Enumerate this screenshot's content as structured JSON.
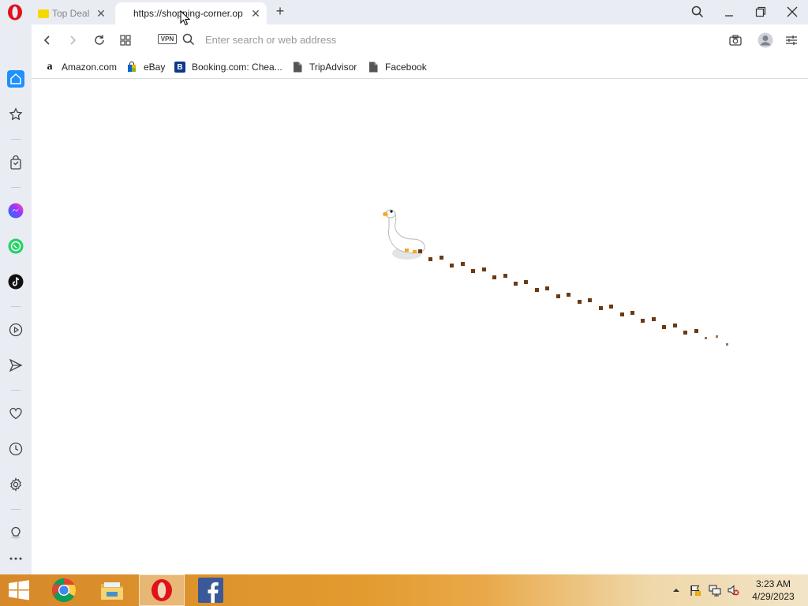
{
  "tabs": [
    {
      "title": "Top Deal",
      "active": false
    },
    {
      "title": "https://shopping-corner.op",
      "active": true
    }
  ],
  "address_bar": {
    "placeholder": "Enter search or web address",
    "value": "",
    "vpn_label": "VPN"
  },
  "bookmarks": [
    {
      "label": "Amazon.com",
      "icon": "amazon-icon"
    },
    {
      "label": "eBay",
      "icon": "ebay-icon"
    },
    {
      "label": "Booking.com: Chea...",
      "icon": "booking-icon"
    },
    {
      "label": "TripAdvisor",
      "icon": "page-icon"
    },
    {
      "label": "Facebook",
      "icon": "page-icon"
    }
  ],
  "sidebar": [
    "home-icon",
    "star-icon",
    "shopping-bag-icon",
    "messenger-icon",
    "whatsapp-icon",
    "tiktok-icon",
    "player-icon",
    "send-icon",
    "heart-icon",
    "history-icon",
    "settings-icon",
    "lightbulb-icon",
    "more-icon"
  ],
  "taskbar": {
    "apps": [
      "start-icon",
      "chrome-icon",
      "file-explorer-icon",
      "opera-icon",
      "facebook-icon"
    ],
    "clock": {
      "time": "3:23 AM",
      "date": "4/29/2023"
    }
  },
  "colors": {
    "accent": "#1e90ff",
    "chrome_bg": "#e9ecf3",
    "opera_red": "#e0121b",
    "footprints": "#6b3a13",
    "goose_beak": "#f5a623"
  }
}
